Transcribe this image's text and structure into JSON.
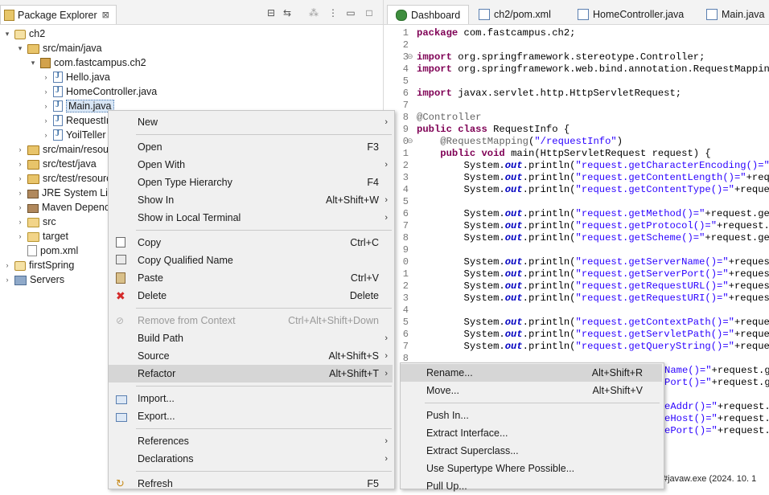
{
  "explorer": {
    "tab_label": "Package Explorer",
    "close_glyph": "⊠",
    "toolbar_icons": [
      "collapse-all-icon",
      "link-with-editor-icon",
      "filters-icon",
      "view-menu-icon",
      "minimize-icon",
      "maximize-icon"
    ],
    "tree": [
      {
        "label": "ch2",
        "icon": "maven-project-icon",
        "indent": 0,
        "twisty": "▾"
      },
      {
        "label": "src/main/java",
        "icon": "source-folder-icon",
        "indent": 1,
        "twisty": "▾"
      },
      {
        "label": "com.fastcampus.ch2",
        "icon": "package-icon",
        "indent": 2,
        "twisty": "▾"
      },
      {
        "label": "Hello.java",
        "icon": "java-file-icon",
        "indent": 3,
        "twisty": "›"
      },
      {
        "label": "HomeController.java",
        "icon": "java-file-icon",
        "indent": 3,
        "twisty": "›"
      },
      {
        "label": "Main.java",
        "icon": "java-file-icon",
        "indent": 3,
        "twisty": "›",
        "selected": true
      },
      {
        "label": "RequestIr",
        "icon": "java-file-icon",
        "indent": 3,
        "twisty": "›"
      },
      {
        "label": "YoilTeller",
        "icon": "java-file-icon",
        "indent": 3,
        "twisty": "›"
      },
      {
        "label": "src/main/resou",
        "icon": "source-folder-icon",
        "indent": 1,
        "twisty": "›"
      },
      {
        "label": "src/test/java",
        "icon": "source-folder-icon",
        "indent": 1,
        "twisty": "›"
      },
      {
        "label": "src/test/resourc",
        "icon": "source-folder-icon",
        "indent": 1,
        "twisty": "›"
      },
      {
        "label": "JRE System Lib",
        "icon": "library-icon",
        "indent": 1,
        "twisty": "›"
      },
      {
        "label": "Maven Depenc",
        "icon": "library-icon",
        "indent": 1,
        "twisty": "›"
      },
      {
        "label": "src",
        "icon": "folder-icon",
        "indent": 1,
        "twisty": "›"
      },
      {
        "label": "target",
        "icon": "folder-icon",
        "indent": 1,
        "twisty": "›"
      },
      {
        "label": "pom.xml",
        "icon": "xml-file-icon",
        "indent": 1,
        "twisty": ""
      },
      {
        "label": "firstSpring",
        "icon": "maven-project-icon",
        "indent": 0,
        "twisty": "›"
      },
      {
        "label": "Servers",
        "icon": "servers-folder-icon",
        "indent": 0,
        "twisty": "›"
      }
    ]
  },
  "editor": {
    "tabs": [
      {
        "label": "Dashboard",
        "icon": "spring-dashboard-icon",
        "active": true
      },
      {
        "label": "ch2/pom.xml",
        "icon": "maven-pom-icon"
      },
      {
        "label": "HomeController.java",
        "icon": "java-file-icon"
      },
      {
        "label": "Main.java",
        "icon": "java-file-icon"
      }
    ],
    "line_numbers": [
      "1",
      "2",
      "3",
      "4",
      "5",
      "6",
      "7",
      "8",
      "9",
      "0",
      "1",
      "2",
      "3",
      "4",
      "5",
      "6",
      "7",
      "8",
      "9",
      "0",
      "1",
      "2",
      "3",
      "4",
      "5",
      "6",
      "7",
      "8"
    ],
    "code_lines": [
      [
        {
          "t": "package",
          "c": "kw"
        },
        {
          "t": " com.fastcampus.ch2;"
        }
      ],
      [],
      [
        {
          "t": "import",
          "c": "kw"
        },
        {
          "t": " org.springframework.stereotype.Controller;"
        }
      ],
      [
        {
          "t": "import",
          "c": "kw"
        },
        {
          "t": " org.springframework.web.bind.annotation.RequestMapping;"
        }
      ],
      [],
      [
        {
          "t": "import",
          "c": "kw"
        },
        {
          "t": " javax.servlet.http.HttpServletRequest;"
        }
      ],
      [],
      [
        {
          "t": "@Controller",
          "c": "ann"
        }
      ],
      [
        {
          "t": "public",
          "c": "kw"
        },
        {
          "t": " "
        },
        {
          "t": "class",
          "c": "kw"
        },
        {
          "t": " RequestInfo {"
        }
      ],
      [
        {
          "t": "    "
        },
        {
          "t": "@RequestMapping",
          "c": "ann"
        },
        {
          "t": "("
        },
        {
          "t": "\"/requestInfo\"",
          "c": "str"
        },
        {
          "t": ")"
        }
      ],
      [
        {
          "t": "    "
        },
        {
          "t": "public",
          "c": "kw"
        },
        {
          "t": " "
        },
        {
          "t": "void",
          "c": "kw"
        },
        {
          "t": " main(HttpServletRequest request) {"
        }
      ],
      [
        {
          "t": "        System."
        },
        {
          "t": "out",
          "c": "fld"
        },
        {
          "t": ".println("
        },
        {
          "t": "\"request.getCharacterEncoding()=\"",
          "c": "str"
        },
        {
          "t": "+re"
        }
      ],
      [
        {
          "t": "        System."
        },
        {
          "t": "out",
          "c": "fld"
        },
        {
          "t": ".println("
        },
        {
          "t": "\"request.getContentLength()=\"",
          "c": "str"
        },
        {
          "t": "+reques"
        }
      ],
      [
        {
          "t": "        System."
        },
        {
          "t": "out",
          "c": "fld"
        },
        {
          "t": ".println("
        },
        {
          "t": "\"request.getContentType()=\"",
          "c": "str"
        },
        {
          "t": "+request."
        }
      ],
      [],
      [
        {
          "t": "        System."
        },
        {
          "t": "out",
          "c": "fld"
        },
        {
          "t": ".println("
        },
        {
          "t": "\"request.getMethod()=\"",
          "c": "str"
        },
        {
          "t": "+request.getMe"
        }
      ],
      [
        {
          "t": "        System."
        },
        {
          "t": "out",
          "c": "fld"
        },
        {
          "t": ".println("
        },
        {
          "t": "\"request.getProtocol()=\"",
          "c": "str"
        },
        {
          "t": "+request.get"
        }
      ],
      [
        {
          "t": "        System."
        },
        {
          "t": "out",
          "c": "fld"
        },
        {
          "t": ".println("
        },
        {
          "t": "\"request.getScheme()=\"",
          "c": "str"
        },
        {
          "t": "+request.getSc"
        }
      ],
      [],
      [
        {
          "t": "        System."
        },
        {
          "t": "out",
          "c": "fld"
        },
        {
          "t": ".println("
        },
        {
          "t": "\"request.getServerName()=\"",
          "c": "str"
        },
        {
          "t": "+request.g"
        }
      ],
      [
        {
          "t": "        System."
        },
        {
          "t": "out",
          "c": "fld"
        },
        {
          "t": ".println("
        },
        {
          "t": "\"request.getServerPort()=\"",
          "c": "str"
        },
        {
          "t": "+request.g"
        }
      ],
      [
        {
          "t": "        System."
        },
        {
          "t": "out",
          "c": "fld"
        },
        {
          "t": ".println("
        },
        {
          "t": "\"request.getRequestURL()=\"",
          "c": "str"
        },
        {
          "t": "+request.g"
        }
      ],
      [
        {
          "t": "        System."
        },
        {
          "t": "out",
          "c": "fld"
        },
        {
          "t": ".println("
        },
        {
          "t": "\"request.getRequestURI()=\"",
          "c": "str"
        },
        {
          "t": "+request.g"
        }
      ],
      [],
      [
        {
          "t": "        System."
        },
        {
          "t": "out",
          "c": "fld"
        },
        {
          "t": ".println("
        },
        {
          "t": "\"request.getContextPath()=\"",
          "c": "str"
        },
        {
          "t": "+request."
        }
      ],
      [
        {
          "t": "        System."
        },
        {
          "t": "out",
          "c": "fld"
        },
        {
          "t": ".println("
        },
        {
          "t": "\"request.getServletPath()=\"",
          "c": "str"
        },
        {
          "t": "+request."
        }
      ],
      [
        {
          "t": "        System."
        },
        {
          "t": "out",
          "c": "fld"
        },
        {
          "t": ".println("
        },
        {
          "t": "\"request.getQueryString()=\"",
          "c": "str"
        },
        {
          "t": "+request."
        }
      ],
      []
    ],
    "peek_lines": [
      [
        {
          "t": "Name()=\"",
          "c": "str"
        },
        {
          "t": "+request.ge"
        }
      ],
      [
        {
          "t": "Port()=\"",
          "c": "str"
        },
        {
          "t": "+request.ge"
        }
      ],
      [],
      [
        {
          "t": "eAddr()=\"",
          "c": "str"
        },
        {
          "t": "+request.g"
        }
      ],
      [
        {
          "t": "eHost()=\"",
          "c": "str"
        },
        {
          "t": "+request.g"
        }
      ],
      [
        {
          "t": "ePort()=\"",
          "c": "str"
        },
        {
          "t": "+request.g"
        }
      ]
    ],
    "console_fragment": "#javaw.exe  (2024. 10. 1"
  },
  "context_menu": {
    "items": [
      {
        "label": "New",
        "shortcut": "",
        "submenu": true,
        "icon": ""
      },
      {
        "sep": true
      },
      {
        "label": "Open",
        "shortcut": "F3",
        "submenu": false,
        "icon": ""
      },
      {
        "label": "Open With",
        "shortcut": "",
        "submenu": true,
        "icon": ""
      },
      {
        "label": "Open Type Hierarchy",
        "shortcut": "F4",
        "submenu": false,
        "icon": ""
      },
      {
        "label": "Show In",
        "shortcut": "Alt+Shift+W",
        "submenu": true,
        "icon": ""
      },
      {
        "label": "Show in Local Terminal",
        "shortcut": "",
        "submenu": true,
        "icon": ""
      },
      {
        "sep": true
      },
      {
        "label": "Copy",
        "shortcut": "Ctrl+C",
        "submenu": false,
        "icon": "copy-icon"
      },
      {
        "label": "Copy Qualified Name",
        "shortcut": "",
        "submenu": false,
        "icon": "copy-qualified-name-icon"
      },
      {
        "label": "Paste",
        "shortcut": "Ctrl+V",
        "submenu": false,
        "icon": "paste-icon"
      },
      {
        "label": "Delete",
        "shortcut": "Delete",
        "submenu": false,
        "icon": "delete-icon"
      },
      {
        "sep": true
      },
      {
        "label": "Remove from Context",
        "shortcut": "Ctrl+Alt+Shift+Down",
        "submenu": false,
        "icon": "remove-context-icon",
        "disabled": true
      },
      {
        "label": "Build Path",
        "shortcut": "",
        "submenu": true,
        "icon": ""
      },
      {
        "label": "Source",
        "shortcut": "Alt+Shift+S",
        "submenu": true,
        "icon": ""
      },
      {
        "label": "Refactor",
        "shortcut": "Alt+Shift+T",
        "submenu": true,
        "icon": "",
        "highlighted": true
      },
      {
        "sep": true
      },
      {
        "label": "Import...",
        "shortcut": "",
        "submenu": false,
        "icon": "import-icon"
      },
      {
        "label": "Export...",
        "shortcut": "",
        "submenu": false,
        "icon": "export-icon"
      },
      {
        "sep": true
      },
      {
        "label": "References",
        "shortcut": "",
        "submenu": true,
        "icon": ""
      },
      {
        "label": "Declarations",
        "shortcut": "",
        "submenu": true,
        "icon": ""
      },
      {
        "sep": true
      },
      {
        "label": "Refresh",
        "shortcut": "F5",
        "submenu": false,
        "icon": "refresh-icon"
      }
    ]
  },
  "refactor_submenu": {
    "items": [
      {
        "label": "Rename...",
        "shortcut": "Alt+Shift+R",
        "highlighted": true
      },
      {
        "label": "Move...",
        "shortcut": "Alt+Shift+V"
      },
      {
        "sep": true
      },
      {
        "label": "Push In...",
        "shortcut": ""
      },
      {
        "label": "Extract Interface...",
        "shortcut": ""
      },
      {
        "label": "Extract Superclass...",
        "shortcut": ""
      },
      {
        "label": "Use Supertype Where Possible...",
        "shortcut": ""
      },
      {
        "label": "Pull Up...",
        "shortcut": ""
      }
    ]
  },
  "colors": {
    "keyword": "#7f0055",
    "string": "#2a00ff",
    "annotation": "#646464",
    "field": "#0000c0",
    "menu_bg": "#f0f0f0",
    "menu_highlight": "#d6d6d6",
    "delete_red": "#d42a2a"
  }
}
